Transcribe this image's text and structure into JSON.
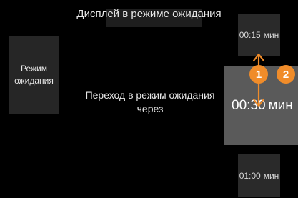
{
  "header": {
    "title": "Дисплей в режиме ожидания"
  },
  "mode_tile": {
    "label": "Режим ожидания"
  },
  "description": {
    "text": "Переход в режим ожидания через"
  },
  "time_options": [
    {
      "value": "00:15",
      "unit": "мин"
    },
    {
      "value": "00:30",
      "unit": "мин",
      "selected": true
    },
    {
      "value": "01:00",
      "unit": "мин"
    }
  ],
  "annotations": {
    "badge_1": "1",
    "badge_2": "2",
    "arrow_icon": "up-down-arrow-icon",
    "accent_color": "#f08c2a"
  },
  "colors": {
    "background": "#000000",
    "tile": "#2a2a2a",
    "selected_tile": "#5a5a5a"
  }
}
